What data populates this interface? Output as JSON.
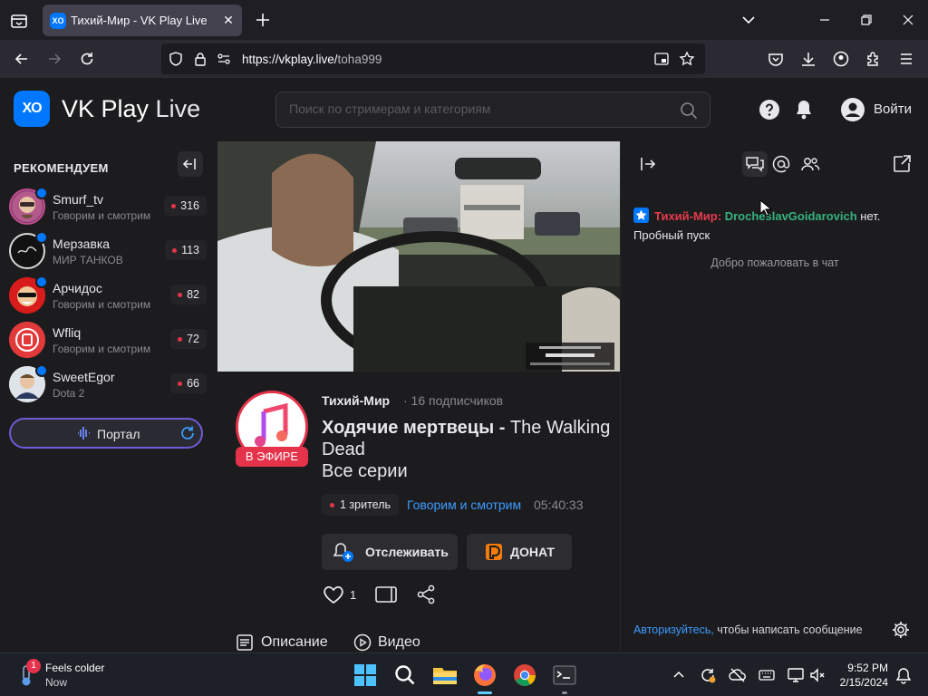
{
  "browser": {
    "tab_title": "Тихий-Мир - VK Play Live",
    "tab_favicon": "XO",
    "url_host": "https://vkplay.live/",
    "url_path": "toha999"
  },
  "site": {
    "logo_mark": "XO",
    "logo_bold": "VK Play",
    "logo_light": " Live",
    "search_placeholder": "Поиск по стримерам и категориям",
    "login_label": "Войти",
    "accent": "#0077ff",
    "live_red": "#e5334b"
  },
  "sidebar": {
    "title": "РЕКОМЕНДУЕМ",
    "streamers": [
      {
        "name": "Smurf_tv",
        "category": "Говорим и смотрим",
        "viewers": "316",
        "verified": true
      },
      {
        "name": "Мерзавка",
        "category": "МИР ТАНКОВ",
        "viewers": "113",
        "verified": true
      },
      {
        "name": "Арчидос",
        "category": "Говорим и смотрим",
        "viewers": "82",
        "verified": true
      },
      {
        "name": "Wfliq",
        "category": "Говорим и смотрим",
        "viewers": "72",
        "verified": false
      },
      {
        "name": "SweetEgor",
        "category": "Dota 2",
        "viewers": "66",
        "verified": true
      }
    ],
    "portal_label": "Портал"
  },
  "stream": {
    "live_badge": "В ЭФИРЕ",
    "channel_name": "Тихий-Мир",
    "subscribers": "· 16 подписчиков",
    "title_bold": "Ходячие мертвецы - ",
    "title_rest": "The Walking Dead",
    "title_line3": "Все серии",
    "viewers": "1 зритель",
    "category": "Говорим и смотрим",
    "uptime": "05:40:33",
    "follow_label": "Отслеживать",
    "donate_label": "ДОНАТ",
    "likes": "1",
    "tab_description": "Описание",
    "tab_video": "Видео"
  },
  "chat": {
    "author": "Тихий-Мир:",
    "mention": "DrocheslavGoidarovich",
    "text_tail": " нет.",
    "text_line2": "Пробный пуск",
    "welcome": "Добро пожаловать в чат",
    "auth_link": "Авторизуйтесь,",
    "auth_text": " чтобы написать сообщение"
  },
  "taskbar": {
    "weather_main": "Feels colder",
    "weather_sub": "Now",
    "notification_count": "1",
    "time": "9:52 PM",
    "date": "2/15/2024"
  }
}
